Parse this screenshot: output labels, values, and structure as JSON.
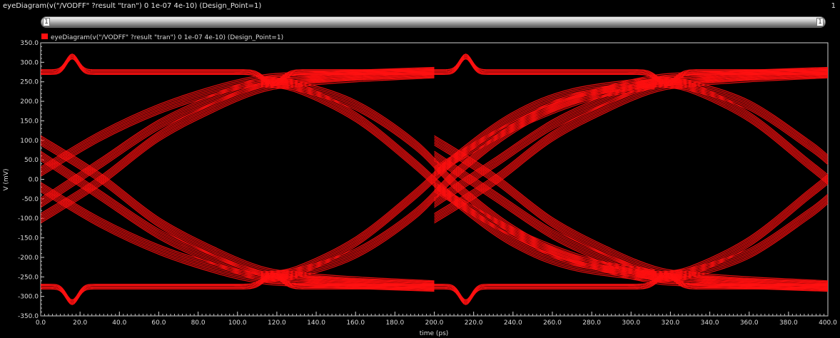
{
  "window": {
    "title": "eyeDiagram(v(\"/VODFF\" ?result \"tran\") 0 1e-07 4e-10) (Design_Point=1)",
    "index_label": "1"
  },
  "scrollbar": {
    "left_label": "1",
    "right_label": "1"
  },
  "colors": {
    "trace": "#ff1010",
    "background": "#000000",
    "axis": "#d0d0d0",
    "text": "#dcdcdc"
  },
  "chart_data": {
    "type": "line",
    "legend": {
      "position": "top-left",
      "entries": [
        "eyeDiagram(v(\"/VODFF\" ?result \"tran\") 0 1e-07 4e-10) (Design_Point=1)"
      ]
    },
    "xlabel": "time (ps)",
    "ylabel": "V (mV)",
    "xlim": [
      0,
      400
    ],
    "ylim": [
      -350,
      350
    ],
    "x_ticks": [
      "0.0",
      "20.0",
      "40.0",
      "60.0",
      "80.0",
      "100.0",
      "120.0",
      "140.0",
      "160.0",
      "180.0",
      "200.0",
      "220.0",
      "240.0",
      "260.0",
      "280.0",
      "300.0",
      "320.0",
      "340.0",
      "360.0",
      "380.0",
      "400.0"
    ],
    "y_ticks": [
      "350.0",
      "300.0",
      "250.0",
      "200.0",
      "150.0",
      "100.0",
      "50.0",
      "0.0",
      "-50.0",
      "-100.0",
      "-150.0",
      "-200.0",
      "-250.0",
      "-300.0",
      "-350.0"
    ],
    "grid": false,
    "high_level": 275,
    "low_level": -275,
    "bit_period": 200,
    "transition_times": [
      10,
      112,
      212,
      312
    ],
    "overshoot_times": [
      16,
      216
    ],
    "overshoot_amplitude": 40,
    "rising_paths": [
      {
        "x": [
          0,
          30,
          60,
          90,
          112,
          130,
          160,
          200
        ],
        "y": [
          -100,
          -5,
          110,
          190,
          235,
          250,
          262,
          272
        ]
      },
      {
        "x": [
          0,
          30,
          60,
          90,
          112,
          130,
          160,
          200
        ],
        "y": [
          -60,
          40,
          140,
          210,
          248,
          258,
          266,
          274
        ]
      },
      {
        "x": [
          0,
          30,
          60,
          90,
          112,
          130,
          160,
          200
        ],
        "y": [
          20,
          110,
          180,
          230,
          255,
          262,
          268,
          275
        ]
      },
      {
        "x": [
          200,
          230,
          260,
          290,
          312,
          330,
          360,
          400
        ],
        "y": [
          -100,
          -5,
          110,
          190,
          235,
          250,
          262,
          272
        ]
      },
      {
        "x": [
          200,
          230,
          260,
          290,
          312,
          330,
          360,
          400
        ],
        "y": [
          -60,
          40,
          140,
          210,
          248,
          258,
          266,
          274
        ]
      },
      {
        "x": [
          200,
          230,
          260,
          290,
          312,
          330,
          360,
          400
        ],
        "y": [
          20,
          110,
          180,
          230,
          255,
          262,
          268,
          275
        ]
      }
    ],
    "falling_paths": [
      {
        "x": [
          0,
          30,
          60,
          90,
          112,
          130,
          160,
          200
        ],
        "y": [
          100,
          5,
          -110,
          -190,
          -235,
          -250,
          -262,
          -272
        ]
      },
      {
        "x": [
          0,
          30,
          60,
          90,
          112,
          130,
          160,
          200
        ],
        "y": [
          60,
          -40,
          -140,
          -210,
          -248,
          -258,
          -266,
          -274
        ]
      },
      {
        "x": [
          0,
          30,
          60,
          90,
          112,
          130,
          160,
          200
        ],
        "y": [
          -20,
          -110,
          -180,
          -230,
          -255,
          -262,
          -268,
          -275
        ]
      },
      {
        "x": [
          200,
          230,
          260,
          290,
          312,
          330,
          360,
          400
        ],
        "y": [
          100,
          5,
          -110,
          -190,
          -235,
          -250,
          -262,
          -272
        ]
      },
      {
        "x": [
          200,
          230,
          260,
          290,
          312,
          330,
          360,
          400
        ],
        "y": [
          60,
          -40,
          -140,
          -210,
          -248,
          -258,
          -266,
          -274
        ]
      },
      {
        "x": [
          200,
          230,
          260,
          290,
          312,
          330,
          360,
          400
        ],
        "y": [
          -20,
          -110,
          -180,
          -230,
          -255,
          -262,
          -268,
          -275
        ]
      }
    ],
    "mid_rising_paths": [
      {
        "x": [
          112,
          130,
          160,
          190,
          212,
          240,
          270,
          312
        ],
        "y": [
          -250,
          -235,
          -160,
          -40,
          60,
          160,
          220,
          250
        ]
      },
      {
        "x": [
          112,
          130,
          160,
          190,
          212,
          240,
          270,
          312
        ],
        "y": [
          -250,
          -240,
          -190,
          -90,
          20,
          130,
          205,
          245
        ]
      },
      {
        "x": [
          312,
          330,
          360,
          390,
          400
        ],
        "y": [
          -250,
          -235,
          -160,
          -40,
          0
        ]
      },
      {
        "x": [
          312,
          330,
          360,
          390,
          400
        ],
        "y": [
          -250,
          -240,
          -190,
          -90,
          -50
        ]
      }
    ],
    "mid_falling_paths": [
      {
        "x": [
          112,
          130,
          160,
          190,
          212,
          240,
          270,
          312
        ],
        "y": [
          250,
          235,
          160,
          40,
          -60,
          -160,
          -220,
          -250
        ]
      },
      {
        "x": [
          112,
          130,
          160,
          190,
          212,
          240,
          270,
          312
        ],
        "y": [
          250,
          240,
          190,
          90,
          -20,
          -130,
          -205,
          -245
        ]
      },
      {
        "x": [
          312,
          330,
          360,
          390,
          400
        ],
        "y": [
          250,
          235,
          160,
          40,
          0
        ]
      },
      {
        "x": [
          312,
          330,
          360,
          390,
          400
        ],
        "y": [
          250,
          240,
          190,
          90,
          50
        ]
      }
    ]
  }
}
